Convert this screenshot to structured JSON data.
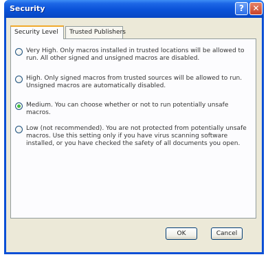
{
  "window": {
    "title": "Security",
    "help_glyph": "?",
    "close_glyph": "✕"
  },
  "tabs": [
    {
      "label": "Security Level",
      "active": true
    },
    {
      "label": "Trusted Publishers",
      "active": false
    }
  ],
  "options": [
    {
      "text": "Very High. Only macros installed in trusted locations will be allowed to run. All other signed and unsigned macros are disabled.",
      "checked": false
    },
    {
      "text": "High. Only signed macros from trusted sources will be allowed to run. Unsigned macros are automatically disabled.",
      "checked": false
    },
    {
      "text": "Medium. You can choose whether or not to run potentially unsafe macros.",
      "checked": true
    },
    {
      "text": "Low (not recommended). You are not protected from potentially unsafe macros. Use this setting only if you have virus scanning software installed, or you have checked the safety of all documents you open.",
      "checked": false
    }
  ],
  "buttons": {
    "ok": "OK",
    "cancel": "Cancel"
  }
}
